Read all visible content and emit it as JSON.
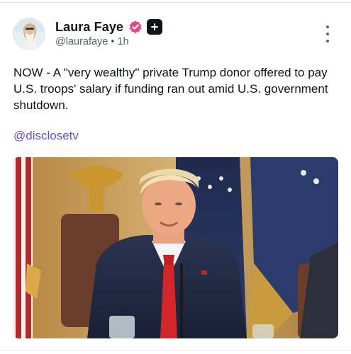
{
  "author": {
    "display_name": "Laura Faye",
    "handle": "@laurafaye",
    "separator": "•",
    "time": "1h",
    "verified_badge_color": "#e8468f"
  },
  "post": {
    "text": "NOW - A \"very wealthy\" private Trump donor offered to pay U.S. troops' salary if funding ran out amid U.S. government shutdown.",
    "mention": "@disclosetv"
  },
  "colors": {
    "text": "#0f1419",
    "muted": "#536471",
    "link": "#5c54d6"
  }
}
